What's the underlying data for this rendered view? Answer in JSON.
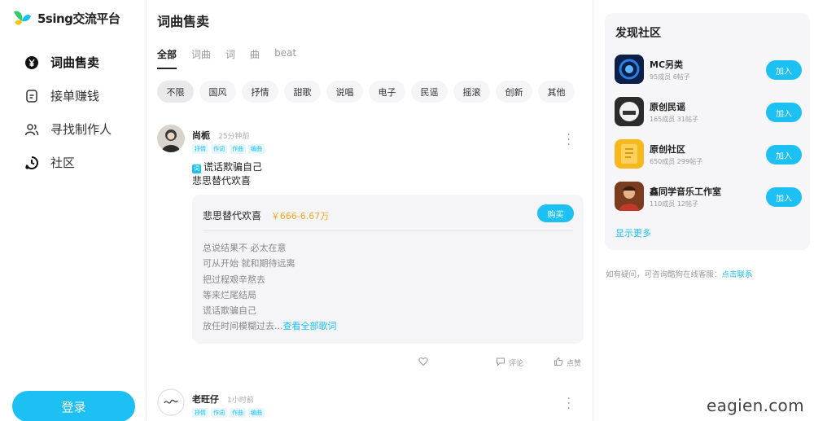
{
  "app": {
    "logo_text": "5sing交流平台"
  },
  "sidebar": {
    "items": [
      {
        "label": "词曲售卖",
        "icon": "yen-icon"
      },
      {
        "label": "接单赚钱",
        "icon": "document-icon"
      },
      {
        "label": "寻找制作人",
        "icon": "users-icon"
      },
      {
        "label": "社区",
        "icon": "community-icon"
      }
    ],
    "login_label": "登录"
  },
  "main": {
    "title": "词曲售卖",
    "tabs": [
      "全部",
      "词曲",
      "词",
      "曲",
      "beat"
    ],
    "active_tab": "全部",
    "chips": [
      "不限",
      "国风",
      "抒情",
      "甜歌",
      "说唱",
      "电子",
      "民谣",
      "摇滚",
      "创新",
      "其他"
    ],
    "posts": [
      {
        "author": "尚栀",
        "time": "25分钟前",
        "tags": [
          "抒情",
          "作词",
          "作曲",
          "编曲"
        ],
        "badge": "词",
        "line1": "谎话欺骗自己",
        "line2": "悲思替代欢喜",
        "card_title": "悲思替代欢喜",
        "price": "￥666-6.67万",
        "buy_label": "购买",
        "lyrics": [
          "总说结果不 必太在意",
          "可从开始 就和期待远离",
          "把过程艰辛熬去",
          "等来烂尾结局",
          "谎话欺骗自己",
          "放任时间模糊过去..."
        ],
        "lyrics_link": "查看全部歌词",
        "comment_label": "评论",
        "like_label": "点赞"
      },
      {
        "author": "老旺仔",
        "time": "1小时前",
        "tags": [
          "抒情",
          "作词",
          "作曲",
          "编曲"
        ]
      }
    ]
  },
  "right": {
    "title": "发现社区",
    "communities": [
      {
        "name": "MC另类",
        "meta": "95成员 6帖子",
        "join_label": "加入"
      },
      {
        "name": "原创民谣",
        "meta": "165成员 31帖子",
        "join_label": "加入"
      },
      {
        "name": "原创社区",
        "meta": "650成员 299帖子",
        "join_label": "加入"
      },
      {
        "name": "鑫同学音乐工作室",
        "meta": "110成员 12帖子",
        "join_label": "加入"
      }
    ],
    "show_more": "显示更多",
    "help_text": "如有疑问，可咨询酷狗在线客服：",
    "help_link": "点击联系"
  },
  "watermark": "eagien.com",
  "colors": {
    "accent": "#1cc0f2",
    "price": "#f5a623"
  }
}
